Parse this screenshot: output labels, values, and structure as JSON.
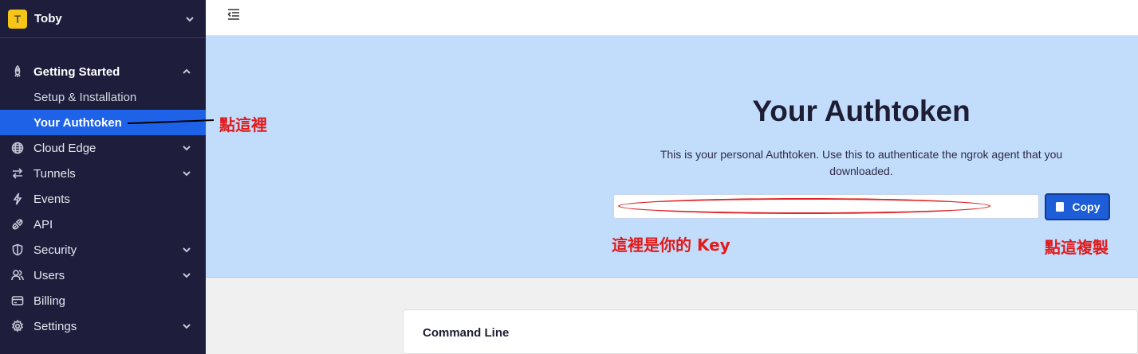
{
  "account": {
    "initial": "T",
    "name": "Toby"
  },
  "sidebar": {
    "section": {
      "label": "Getting Started",
      "icon": "rocket-icon"
    },
    "sub_items": [
      {
        "label": "Setup & Installation",
        "active": false
      },
      {
        "label": "Your Authtoken",
        "active": true
      }
    ],
    "items": [
      {
        "label": "Cloud Edge",
        "icon": "globe-icon",
        "expandable": true
      },
      {
        "label": "Tunnels",
        "icon": "arrows-icon",
        "expandable": true
      },
      {
        "label": "Events",
        "icon": "lightning-icon",
        "expandable": false
      },
      {
        "label": "API",
        "icon": "plug-icon",
        "expandable": false
      },
      {
        "label": "Security",
        "icon": "shield-icon",
        "expandable": true
      },
      {
        "label": "Users",
        "icon": "users-icon",
        "expandable": true
      },
      {
        "label": "Billing",
        "icon": "card-icon",
        "expandable": false
      },
      {
        "label": "Settings",
        "icon": "gear-icon",
        "expandable": true
      }
    ]
  },
  "hero": {
    "title": "Your Authtoken",
    "description": "This is your personal Authtoken. Use this to authenticate the ngrok agent that you downloaded.",
    "token_value": "",
    "copy_label": "Copy"
  },
  "annotations": {
    "click_here": "點這裡",
    "your_key": "這裡是你的 Key",
    "click_copy": "點這複製"
  },
  "card": {
    "title": "Command Line"
  },
  "colors": {
    "sidebar_bg": "#1e1e3c",
    "accent": "#1e62e8",
    "hero_bg": "#c2dcfb",
    "annotation": "#e21a1a"
  }
}
